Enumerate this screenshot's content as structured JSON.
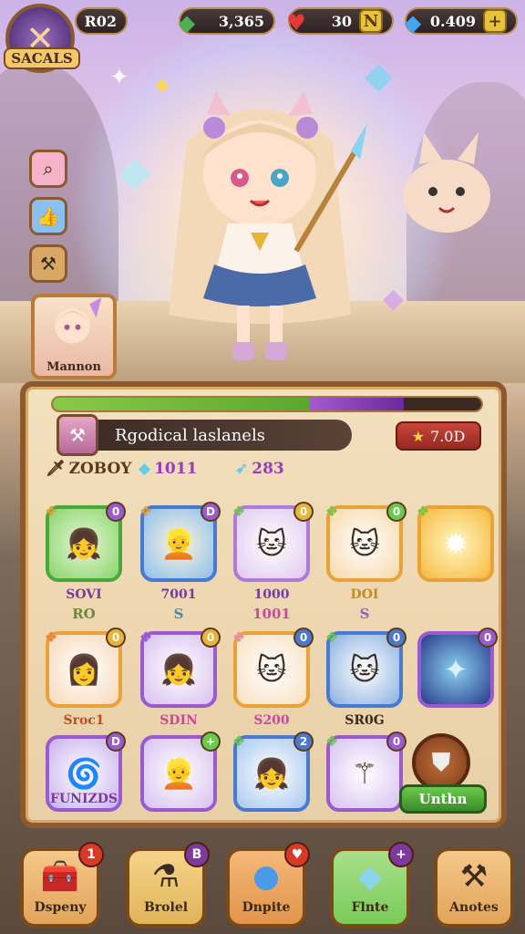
{
  "header": {
    "logo_text": "SACALS",
    "level_text": "R02",
    "currencies": [
      {
        "icon": "green-gem-icon",
        "value": "3,365",
        "color": "#4caf50"
      },
      {
        "icon": "red-heart-icon",
        "value": "30",
        "color": "#e53935"
      },
      {
        "icon": "blue-crystal-icon",
        "value": "0.409",
        "color": "#42a5f5"
      }
    ]
  },
  "side_buttons": [
    {
      "icon": "search-icon",
      "color": "#d86a9a"
    },
    {
      "icon": "thumbs-up-icon",
      "color": "#4a90d9"
    },
    {
      "icon": "hammer-icon",
      "color": "#9a6a3a"
    }
  ],
  "portrait": {
    "label": "Mannon"
  },
  "panel": {
    "title": "Rgodical laslanels",
    "stars_value": "7.0D",
    "xp_progress": 0.6,
    "xp_secondary": 0.22,
    "stats": [
      {
        "icon": "sword-icon",
        "value": "ZOBOY",
        "color": "#5a3a1a"
      },
      {
        "icon": "crystal-icon",
        "value": "1011",
        "color": "#9a3ac0"
      },
      {
        "icon": "blade-icon",
        "value": "283",
        "color": "#9a3ac0"
      }
    ],
    "cards_row1": [
      {
        "icon": "girl-dark-hair-icon",
        "label": "SOVI",
        "sub": "RO",
        "badge": "0"
      },
      {
        "icon": "girl-blonde-icon",
        "label": "7001",
        "sub": "S",
        "badge": "D"
      },
      {
        "icon": "cat-icon",
        "label": "1000",
        "sub": "1001",
        "badge": "0"
      },
      {
        "icon": "cat-sword-icon",
        "label": "DOI",
        "sub": "S",
        "badge": "0"
      },
      {
        "icon": "energy-burst-icon",
        "label": "",
        "sub": "",
        "badge": ""
      }
    ],
    "cards_row2": [
      {
        "icon": "girl-white-hair-icon",
        "label": "Sroc1",
        "badge": "0"
      },
      {
        "icon": "girl-brown-hair-icon",
        "label": "SDIN",
        "badge": "0"
      },
      {
        "icon": "cat-pink-icon",
        "label": "S200",
        "badge": "0"
      },
      {
        "icon": "cat-blue-icon",
        "label": "SR0G",
        "badge": "0"
      },
      {
        "icon": "galaxy-icon",
        "label": "",
        "badge": "0"
      }
    ],
    "cards_row3": [
      {
        "icon": "swirl-icon",
        "label": "FUNIZDS",
        "badge": "D"
      },
      {
        "icon": "girl-blonde-2-icon",
        "label": "",
        "badge": "+"
      },
      {
        "icon": "girl-pink-hair-icon",
        "label": "",
        "badge": "2"
      },
      {
        "icon": "staff-icon",
        "label": "",
        "badge": "0"
      }
    ],
    "unlock_label": "Unthn"
  },
  "nav": [
    {
      "icon": "chest-icon",
      "label": "Dspeny",
      "badge": "1",
      "color": "#e2a45a",
      "badge_color": "#d83a2a"
    },
    {
      "icon": "potion-icon",
      "label": "Brolel",
      "badge": "B",
      "color": "#e2b45a",
      "badge_color": "#7a3aa0"
    },
    {
      "icon": "orb-icon",
      "label": "Dnpite",
      "badge": "♥",
      "color": "#e2944a",
      "badge_color": "#d83a2a"
    },
    {
      "icon": "crystal-shard-icon",
      "label": "Flnte",
      "badge": "+",
      "color": "#7acb5a",
      "badge_color": "#7a3aa0"
    },
    {
      "icon": "anvil-icon",
      "label": "Anotes",
      "badge": "",
      "color": "#e2a45a",
      "badge_color": ""
    }
  ]
}
